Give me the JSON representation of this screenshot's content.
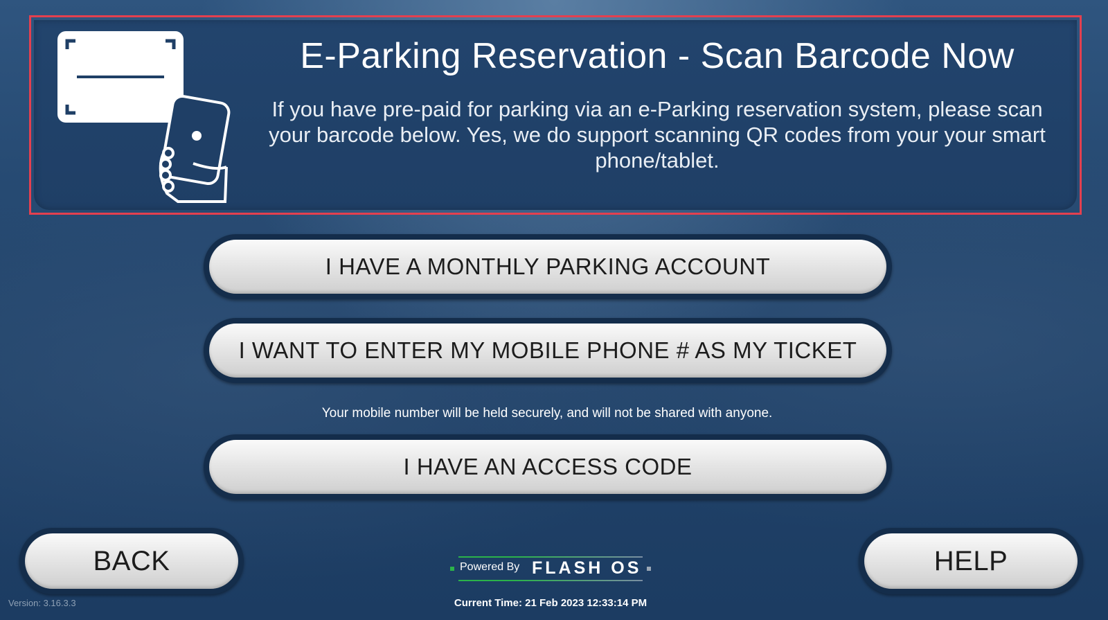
{
  "banner": {
    "title": "E-Parking Reservation - Scan Barcode Now",
    "description": "If you have pre-paid for parking via an e-Parking reservation system, please scan your barcode below. Yes, we do support scanning QR codes from your your smart phone/tablet.",
    "icon": "phone-scanning-barcode-icon"
  },
  "buttons": {
    "monthly": "I HAVE A MONTHLY PARKING ACCOUNT",
    "mobile": "I WANT TO ENTER MY MOBILE PHONE # AS MY TICKET",
    "access_code": "I HAVE AN ACCESS CODE",
    "back": "BACK",
    "help": "HELP"
  },
  "mobile_note": "Your mobile number will be held securely, and will not be shared with anyone.",
  "footer": {
    "powered_by": "Powered By",
    "brand": "FLASH OS",
    "current_time": "Current Time: 21 Feb 2023 12:33:14 PM",
    "version": "Version: 3.16.3.3"
  },
  "colors": {
    "highlight_border": "#e4404f",
    "background": "#23466e",
    "brand_green": "#2bb34a"
  }
}
